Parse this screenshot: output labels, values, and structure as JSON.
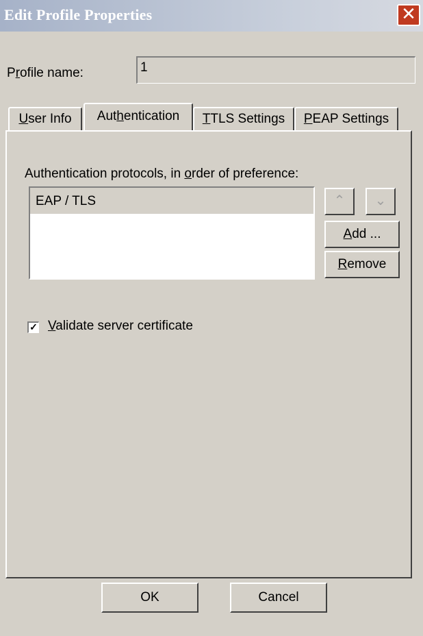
{
  "window": {
    "title": "Edit Profile Properties",
    "close_glyph": "✕"
  },
  "profile": {
    "label": "Profile name:",
    "value": "1"
  },
  "tabs": [
    {
      "label": "User Info",
      "active": false
    },
    {
      "label": "Authentication",
      "active": true
    },
    {
      "label": "TTLS Settings",
      "active": false
    },
    {
      "label": "PEAP Settings",
      "active": false
    }
  ],
  "authentication": {
    "protocols_label": "Authentication protocols, in order of preference:",
    "protocols": [
      "EAP / TLS"
    ],
    "move_up_icon": "double-chevron-up-icon",
    "move_down_icon": "double-chevron-down-icon",
    "add_label": "Add ...",
    "remove_label": "Remove",
    "validate_label": "Validate server certificate",
    "validate_checked": true
  },
  "footer": {
    "ok_label": "OK",
    "cancel_label": "Cancel"
  }
}
